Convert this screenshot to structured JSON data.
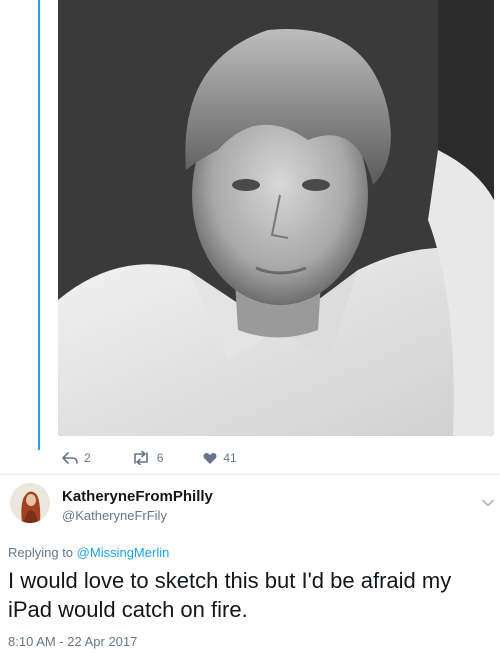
{
  "original_tweet": {
    "image_alt": "Black and white portrait photo",
    "actions": {
      "reply_count": "2",
      "retweet_count": "6",
      "like_count": "41"
    }
  },
  "reply_tweet": {
    "display_name": "KatheryneFromPhilly",
    "handle": "@KatheryneFrFily",
    "replying_to_prefix": "Replying to",
    "replying_to_handle": "@MissingMerlin",
    "text": "I would love to sketch this but I'd be afraid my iPad would catch on fire.",
    "timestamp": "8:10 AM - 22 Apr 2017"
  },
  "icons": {
    "reply": "reply-icon",
    "retweet": "retweet-icon",
    "like": "heart-icon",
    "menu": "chevron-down-icon"
  },
  "colors": {
    "accent": "#1da1f2",
    "secondary_text": "#657786",
    "primary_text": "#14171a"
  }
}
